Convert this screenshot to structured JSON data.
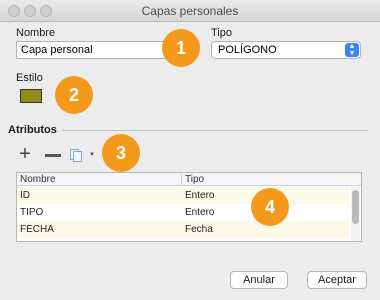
{
  "window": {
    "title": "Capas personales"
  },
  "form": {
    "name_label": "Nombre",
    "name_value": "Capa personal",
    "type_label": "Tipo",
    "type_value": "POLÍGONO",
    "style_label": "Estilo",
    "style_color": "#8f8b14"
  },
  "attributes": {
    "section_label": "Atributos",
    "toolbar": {
      "add_icon": "plus-icon",
      "remove_icon": "minus-icon",
      "duplicate_icon": "copy-icon"
    },
    "columns": [
      "Nombre",
      "Tipo"
    ],
    "rows": [
      {
        "name": "ID",
        "type": "Entero"
      },
      {
        "name": "TIPO",
        "type": "Entero"
      },
      {
        "name": "FECHA",
        "type": "Fecha"
      }
    ]
  },
  "buttons": {
    "cancel": "Anular",
    "accept": "Aceptar"
  },
  "callouts": [
    "1",
    "2",
    "3",
    "4"
  ],
  "colors": {
    "callout": "#f39a1b",
    "select_accent": "#3b86f7"
  }
}
